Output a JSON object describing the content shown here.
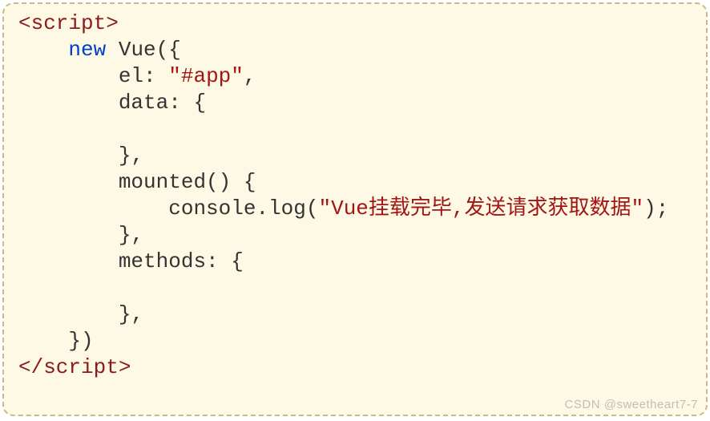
{
  "code": {
    "openTag": "<script>",
    "closeTag": "</scr",
    "closeTag2": "ipt>",
    "kwNew": "new",
    "vue": "Vue",
    "openParenBrace": "({",
    "elKey": "el",
    "colon": ": ",
    "elVal": "\"#app\"",
    "comma": ",",
    "dataKey": "data",
    "braceOpen": "{",
    "braceClose": "}",
    "mounted": "mounted",
    "parens": "()",
    "consoleLog": "console.log",
    "logStr": "\"Vue挂载完毕,发送请求获取数据\"",
    "semi": ";",
    "methodsKey": "methods",
    "closeParenBrace": "})"
  },
  "watermark": "CSDN @sweetheart7-7"
}
